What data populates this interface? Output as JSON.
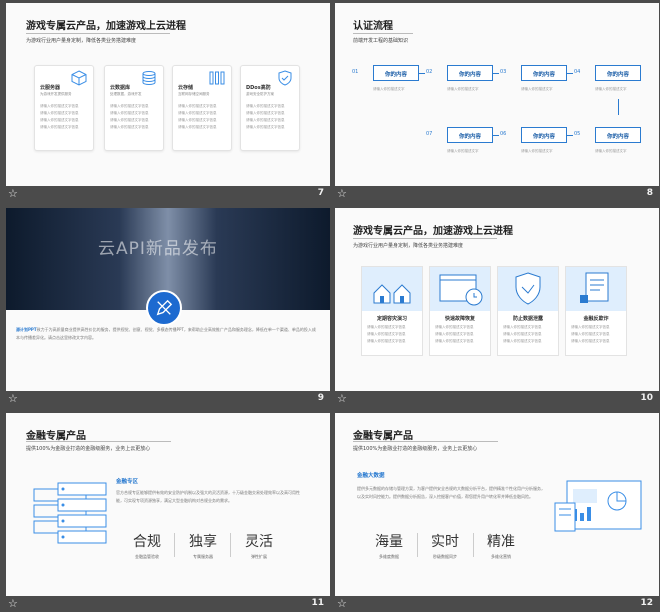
{
  "slides": [
    {
      "number": "7",
      "title": "游戏专属云产品，加速游戏上云进程",
      "subtitle": "为游戏行业用户量身定制，降低各类业务搭建难度",
      "cards": [
        {
          "title": "云服务器",
          "sub": "为游戏开发提供服务",
          "lines": [
            "请输入你的描述文字信息",
            "请输入你的描述文字信息",
            "请输入你的描述文字信息",
            "请输入你的描述文字信息"
          ]
        },
        {
          "title": "云数据库",
          "sub": "处理数据，游戏开发",
          "lines": [
            "请输入你的描述文字信息",
            "请输入你的描述文字信息",
            "请输入你的描述文字信息",
            "请输入你的描述文字信息"
          ]
        },
        {
          "title": "云存储",
          "sub": "互联网存储空间服务",
          "lines": [
            "请输入你的描述文字信息",
            "请输入你的描述文字信息",
            "请输入你的描述文字信息",
            "请输入你的描述文字信息"
          ]
        },
        {
          "title": "DDos高防",
          "sub": "游戏安全防护方案",
          "lines": [
            "请输入你的描述文字信息",
            "请输入你的描述文字信息",
            "请输入你的描述文字信息",
            "请输入你的描述文字信息"
          ]
        }
      ]
    },
    {
      "number": "8",
      "title": "认证流程",
      "subtitle": "前端开发工程的基础知识",
      "steps": [
        {
          "num": "01",
          "label": "你的内容",
          "desc": "请输入你的描述文字"
        },
        {
          "num": "02",
          "label": "你的内容",
          "desc": "请输入你的描述文字"
        },
        {
          "num": "03",
          "label": "你的内容",
          "desc": "请输入你的描述文字"
        },
        {
          "num": "04",
          "label": "你的内容",
          "desc": "请输入你的描述文字"
        },
        {
          "num": "05",
          "label": "你的内容",
          "desc": "请输入你的描述文字"
        },
        {
          "num": "06",
          "label": "你的内容",
          "desc": "请输入你的描述文字"
        },
        {
          "num": "07",
          "label": "你的内容",
          "desc": "请输入你的描述文字"
        }
      ]
    },
    {
      "number": "9",
      "heading": "云API新品发布",
      "body_prefix": "源计划PPT",
      "body": "致力于为高质量商业提供高性价比的服务，提供视觉、创意、视觉、多模态传播PPT，来帮助企业高效推广产品和服务理念，降低在单一个渠道、单品的投入成本与传播差异化。请点击这里修改文字内容。"
    },
    {
      "number": "10",
      "title": "游戏专属云产品，加速游戏上云进程",
      "subtitle": "为游戏行业用户量身定制，降低各类业务搭建难度",
      "cards": [
        {
          "title": "定期容灾演习",
          "lines": [
            "请输入你的描述文字信息",
            "请输入你的描述文字信息",
            "请输入你的描述文字信息"
          ]
        },
        {
          "title": "快速故障恢复",
          "lines": [
            "请输入你的描述文字信息",
            "请输入你的描述文字信息",
            "请输入你的描述文字信息"
          ]
        },
        {
          "title": "防止数据泄露",
          "lines": [
            "请输入你的描述文字信息",
            "请输入你的描述文字信息",
            "请输入你的描述文字信息"
          ]
        },
        {
          "title": "金融反欺诈",
          "lines": [
            "请输入你的描述文字信息",
            "请输入你的描述文字信息",
            "请输入你的描述文字信息"
          ]
        }
      ]
    },
    {
      "number": "11",
      "title": "金融专属产品",
      "subtitle": "提供100%为金融业打造的金融级服务，业务上云更放心",
      "section": "金融专区",
      "para": "官方合规专区能够提供有效的安全防护机制以及强大的灵活资源，十万级金融交易处理效率以及高可用性能，可实现专项资源独享，满足大型金融机构对合规业务的需求。",
      "features": [
        {
          "big": "合规",
          "small": "金融监管验收"
        },
        {
          "big": "独享",
          "small": "专属服务器"
        },
        {
          "big": "灵活",
          "small": "弹性扩展"
        }
      ]
    },
    {
      "number": "12",
      "title": "金融专属产品",
      "subtitle": "提供100%为金融业打造的金融级服务，业务上云更放心",
      "section": "金融大数据",
      "para": "提供多元数据的存储与管理方案，为客户提供安全合规的大数据分析平台，提供精准个性化用户分析服务，以及实时风控能力。提供数据分析报告，深入挖掘客户价值，帮您提升用户转化率并降低金融风险。",
      "features": [
        {
          "big": "海量",
          "small": "多维度数据"
        },
        {
          "big": "实时",
          "small": "秒级数据同步"
        },
        {
          "big": "精准",
          "small": "多维化营销"
        }
      ]
    }
  ],
  "colors": {
    "accent": "#2b7bd0",
    "bg": "#4b4b4b"
  }
}
